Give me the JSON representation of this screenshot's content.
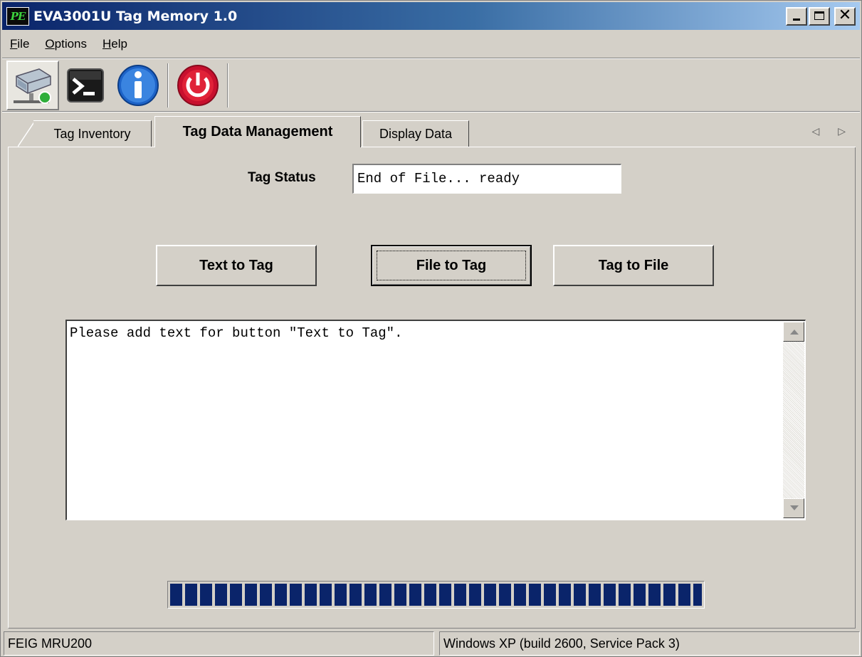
{
  "window": {
    "app_icon_text": "PE",
    "title": "EVA3001U Tag Memory 1.0",
    "minimize_label": "",
    "maximize_label": "",
    "close_label": "✕"
  },
  "menu": [
    {
      "underline": "F",
      "rest": "ile"
    },
    {
      "underline": "O",
      "rest": "ptions"
    },
    {
      "underline": "H",
      "rest": "elp"
    }
  ],
  "toolbar": {
    "icons": [
      "network-drive-icon",
      "console-icon",
      "info-icon",
      "power-icon"
    ]
  },
  "tabs": {
    "items": [
      "Tag Inventory",
      "Tag Data Management",
      "Display Data"
    ],
    "active": "Tag Data Management"
  },
  "tag_status": {
    "label": "Tag Status",
    "value": "End of File... ready"
  },
  "buttons": {
    "text_to_tag": "Text to Tag",
    "file_to_tag": "File to Tag",
    "tag_to_file": "Tag to File"
  },
  "memo": {
    "text": "Please add text for button \"Text to Tag\"."
  },
  "progress": {
    "percent": 100,
    "color": "#0a246a"
  },
  "statusbar": {
    "left": "FEIG MRU200",
    "right": "Windows XP (build 2600, Service Pack 3)"
  },
  "colors": {
    "title_start": "#0a246a",
    "title_end": "#a6caf0",
    "face": "#d4d0c8"
  }
}
